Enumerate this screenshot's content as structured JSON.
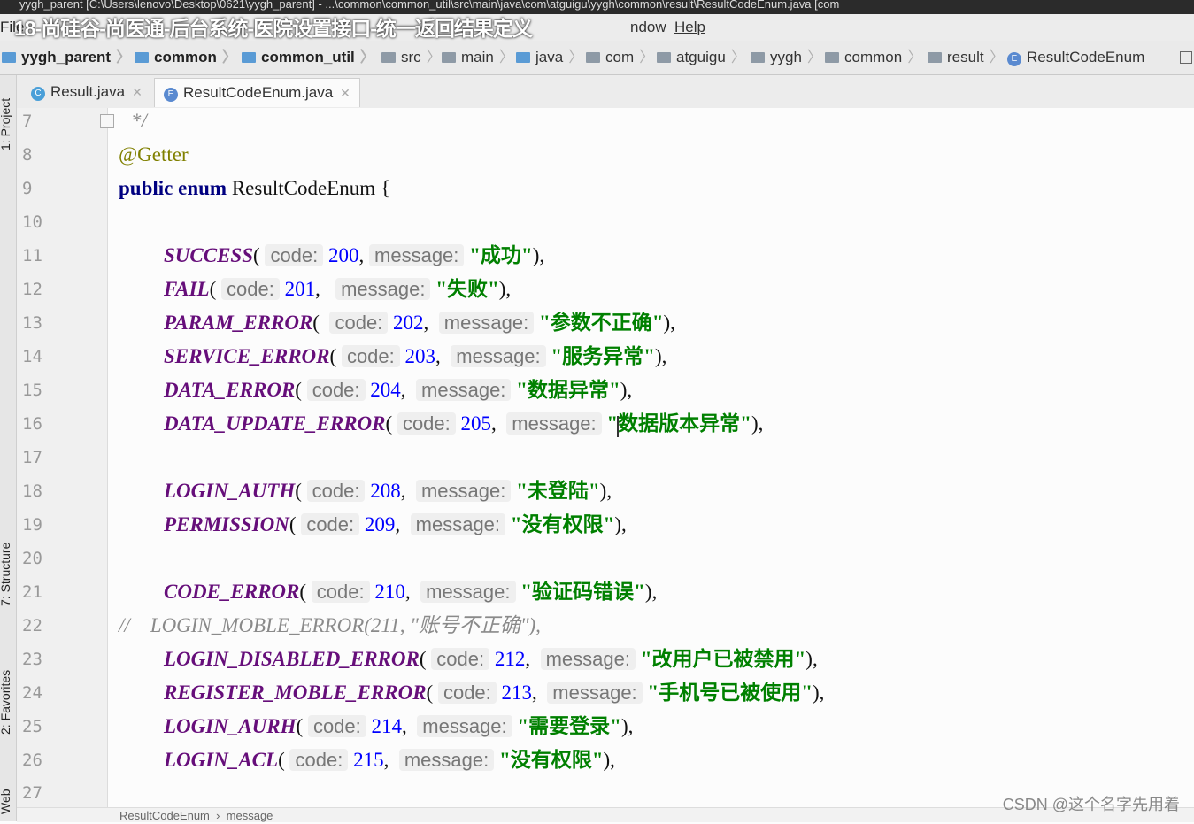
{
  "window": {
    "title": "yygh_parent [C:\\Users\\lenovo\\Desktop\\0621\\yygh_parent] - ...\\common\\common_util\\src\\main\\java\\com\\atguigu\\yygh\\common\\result\\ResultCodeEnum.java [com",
    "overlay_title": "18-尚硅谷-尚医通-后台系统-医院设置接口-统一返回结果定义"
  },
  "menu": {
    "file": "File",
    "window": "ndow",
    "help": "Help"
  },
  "breadcrumb": [
    {
      "label": "yygh_parent",
      "bold": true
    },
    {
      "label": "common",
      "bold": true
    },
    {
      "label": "common_util",
      "bold": true
    },
    {
      "label": "src",
      "bold": false
    },
    {
      "label": "main",
      "bold": false
    },
    {
      "label": "java",
      "bold": false
    },
    {
      "label": "com",
      "bold": false
    },
    {
      "label": "atguigu",
      "bold": false
    },
    {
      "label": "yygh",
      "bold": false
    },
    {
      "label": "common",
      "bold": false
    },
    {
      "label": "result",
      "bold": false
    },
    {
      "label": "ResultCodeEnum",
      "bold": false
    }
  ],
  "side_tools": {
    "project": "1: Project",
    "structure": "7: Structure",
    "favorites": "2: Favorites",
    "web": "Web"
  },
  "tabs": [
    {
      "label": "Result.java",
      "icon": "C",
      "active": false
    },
    {
      "label": "ResultCodeEnum.java",
      "icon": "E",
      "active": true
    }
  ],
  "editor": {
    "line_numbers": [
      "7",
      "8",
      "9",
      "10",
      "11",
      "12",
      "13",
      "14",
      "15",
      "16",
      "17",
      "18",
      "19",
      "20",
      "21",
      "22",
      "23",
      "24",
      "25",
      "26",
      "27"
    ],
    "comment_close": "*/",
    "annotation": "@Getter",
    "decl": {
      "kw1": "public",
      "kw2": "enum",
      "name": "ResultCodeEnum",
      "brace": "{"
    },
    "hint_code": "code:",
    "hint_message": "message:",
    "entries": [
      {
        "name": "SUCCESS",
        "code": "200",
        "message": "\"成功\""
      },
      {
        "name": "FAIL",
        "code": "201",
        "message": "\"失败\""
      },
      {
        "name": "PARAM_ERROR",
        "code": "202",
        "message": "\"参数不正确\""
      },
      {
        "name": "SERVICE_ERROR",
        "code": "203",
        "message": "\"服务异常\""
      },
      {
        "name": "DATA_ERROR",
        "code": "204",
        "message": "\"数据异常\""
      },
      {
        "name": "DATA_UPDATE_ERROR",
        "code": "205",
        "message": "\"数据版本异常\""
      },
      {
        "name": "LOGIN_AUTH",
        "code": "208",
        "message": "\"未登陆\""
      },
      {
        "name": "PERMISSION",
        "code": "209",
        "message": "\"没有权限\""
      },
      {
        "name": "CODE_ERROR",
        "code": "210",
        "message": "\"验证码错误\""
      },
      {
        "name": "LOGIN_DISABLED_ERROR",
        "code": "212",
        "message": "\"改用户已被禁用\""
      },
      {
        "name": "REGISTER_MOBLE_ERROR",
        "code": "213",
        "message": "\"手机号已被使用\""
      },
      {
        "name": "LOGIN_AURH",
        "code": "214",
        "message": "\"需要登录\""
      },
      {
        "name": "LOGIN_ACL",
        "code": "215",
        "message": "\"没有权限\""
      }
    ],
    "commented_line": "//    LOGIN_MOBLE_ERROR(211, \"账号不正确\"),"
  },
  "status": {
    "breadcrumb": "ResultCodeEnum  ›  message"
  },
  "watermark": "CSDN @这个名字先用着"
}
